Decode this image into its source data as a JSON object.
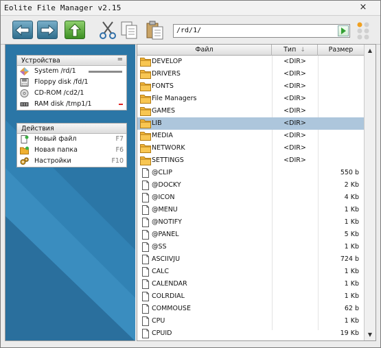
{
  "window": {
    "title": "Eolite File Manager v2.15"
  },
  "titlebar": {
    "close_glyph": "×"
  },
  "toolbar": {
    "buttons": [
      {
        "name": "back",
        "icon": "left-arrow-icon"
      },
      {
        "name": "forward",
        "icon": "right-arrow-icon"
      },
      {
        "name": "up",
        "icon": "up-arrow-icon"
      },
      {
        "name": "cut",
        "icon": "scissors-icon"
      },
      {
        "name": "copy",
        "icon": "copy-icon"
      },
      {
        "name": "paste",
        "icon": "paste-icon"
      }
    ],
    "path": "/rd/1/"
  },
  "devices": {
    "title": "Устройства",
    "collapse_glyph": "=",
    "items": [
      {
        "label": "System /rd/1",
        "icon": "system-drive-icon"
      },
      {
        "label": "Floppy disk /fd/1",
        "icon": "floppy-icon"
      },
      {
        "label": "CD-ROM /cd2/1",
        "icon": "cdrom-icon"
      },
      {
        "label": "RAM disk /tmp1/1",
        "icon": "ram-disk-icon"
      }
    ]
  },
  "actions": {
    "title": "Действия",
    "items": [
      {
        "label": "Новый файл",
        "key": "F7",
        "icon": "new-file-icon"
      },
      {
        "label": "Новая папка",
        "key": "F6",
        "icon": "new-folder-icon"
      },
      {
        "label": "Настройки",
        "key": "F10",
        "icon": "settings-icon"
      }
    ]
  },
  "list": {
    "headers": {
      "name": "Файл",
      "type": "Тип",
      "size": "Размер"
    },
    "sort_glyph": "↓",
    "selected_index": 5,
    "rows": [
      {
        "name": "DEVELOP",
        "type": "<DIR>",
        "size": "",
        "kind": "folder"
      },
      {
        "name": "DRIVERS",
        "type": "<DIR>",
        "size": "",
        "kind": "folder"
      },
      {
        "name": "FONTS",
        "type": "<DIR>",
        "size": "",
        "kind": "folder"
      },
      {
        "name": "File Managers",
        "type": "<DIR>",
        "size": "",
        "kind": "folder"
      },
      {
        "name": "GAMES",
        "type": "<DIR>",
        "size": "",
        "kind": "folder"
      },
      {
        "name": "LIB",
        "type": "<DIR>",
        "size": "",
        "kind": "folder"
      },
      {
        "name": "MEDIA",
        "type": "<DIR>",
        "size": "",
        "kind": "folder"
      },
      {
        "name": "NETWORK",
        "type": "<DIR>",
        "size": "",
        "kind": "folder"
      },
      {
        "name": "SETTINGS",
        "type": "<DIR>",
        "size": "",
        "kind": "folder"
      },
      {
        "name": "@CLIP",
        "type": "",
        "size": "550 b",
        "kind": "file"
      },
      {
        "name": "@DOCKY",
        "type": "",
        "size": "2 Kb",
        "kind": "file"
      },
      {
        "name": "@ICON",
        "type": "",
        "size": "4 Kb",
        "kind": "file"
      },
      {
        "name": "@MENU",
        "type": "",
        "size": "1 Kb",
        "kind": "file"
      },
      {
        "name": "@NOTIFY",
        "type": "",
        "size": "1 Kb",
        "kind": "file"
      },
      {
        "name": "@PANEL",
        "type": "",
        "size": "5 Kb",
        "kind": "file"
      },
      {
        "name": "@SS",
        "type": "",
        "size": "1 Kb",
        "kind": "file"
      },
      {
        "name": "ASCIIVJU",
        "type": "",
        "size": "724 b",
        "kind": "file"
      },
      {
        "name": "CALC",
        "type": "",
        "size": "1 Kb",
        "kind": "file"
      },
      {
        "name": "CALENDAR",
        "type": "",
        "size": "1 Kb",
        "kind": "file"
      },
      {
        "name": "COLRDIAL",
        "type": "",
        "size": "1 Kb",
        "kind": "file"
      },
      {
        "name": "COMMOUSE",
        "type": "",
        "size": "62 b",
        "kind": "file"
      },
      {
        "name": "CPU",
        "type": "",
        "size": "1 Kb",
        "kind": "file"
      },
      {
        "name": "CPUID",
        "type": "",
        "size": "19 Kb",
        "kind": "file"
      }
    ]
  },
  "scrollbar": {
    "up_glyph": "▲",
    "down_glyph": "▼"
  },
  "colors": {
    "panel_bg": "#2b76a6",
    "selection": "#adc6dc",
    "folder": "#f0b030"
  }
}
